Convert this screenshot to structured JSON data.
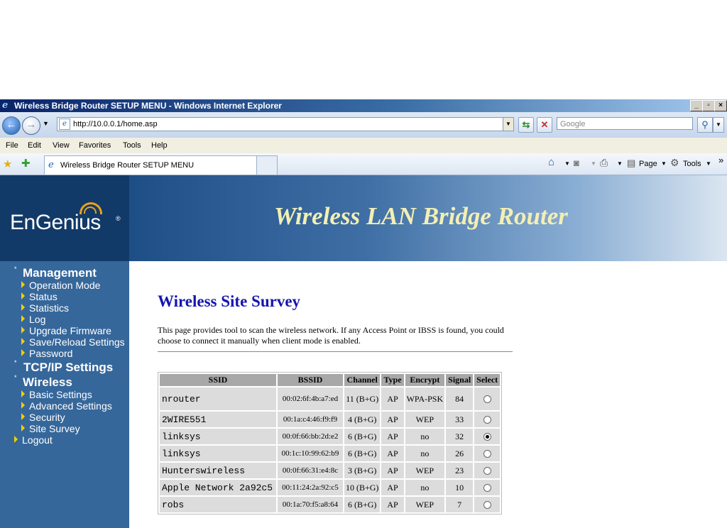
{
  "window": {
    "title": "Wireless Bridge Router SETUP MENU - Windows Internet Explorer",
    "controls": [
      "_",
      "▫",
      "×"
    ]
  },
  "address_bar": {
    "url": "http://10.0.0.1/home.asp",
    "search_placeholder": "Google"
  },
  "menu": [
    "File",
    "Edit",
    "View",
    "Favorites",
    "Tools",
    "Help"
  ],
  "tabs": {
    "active_label": "Wireless Bridge Router SETUP MENU"
  },
  "command_bar": {
    "page_label": "Page",
    "tools_label": "Tools",
    "overflow": "»"
  },
  "header": {
    "logo_text": "EnGenius",
    "logo_mark": "®",
    "banner_title": "Wireless LAN Bridge Router"
  },
  "sidebar": {
    "management": {
      "label": "Management",
      "items": [
        "Operation Mode",
        "Status",
        "Statistics",
        "Log",
        "Upgrade Firmware",
        "Save/Reload Settings",
        "Password"
      ]
    },
    "tcpip": {
      "label": "TCP/IP Settings"
    },
    "wireless": {
      "label": "Wireless",
      "items": [
        "Basic Settings",
        "Advanced Settings",
        "Security",
        "Site Survey"
      ]
    },
    "logout": "Logout"
  },
  "main": {
    "title": "Wireless Site Survey",
    "description": "This page provides tool to scan the wireless network. If any Access Point or IBSS is found, you could choose to connect it manually when client mode is enabled.",
    "table": {
      "headers": [
        "SSID",
        "BSSID",
        "Channel",
        "Type",
        "Encrypt",
        "Signal",
        "Select"
      ],
      "rows": [
        {
          "ssid": "nrouter",
          "bssid": "00:02:6f:4b:a7:ed",
          "channel": "11 (B+G)",
          "type": "AP",
          "encrypt": "WPA-PSK",
          "signal": "84",
          "selected": false
        },
        {
          "ssid": "2WIRE551",
          "bssid": "00:1a:c4:46:f9:f9",
          "channel": "4 (B+G)",
          "type": "AP",
          "encrypt": "WEP",
          "signal": "33",
          "selected": false
        },
        {
          "ssid": "linksys",
          "bssid": "00:0f:66:bb:2d:e2",
          "channel": "6 (B+G)",
          "type": "AP",
          "encrypt": "no",
          "signal": "32",
          "selected": true
        },
        {
          "ssid": "linksys",
          "bssid": "00:1c:10:99:62:b9",
          "channel": "6 (B+G)",
          "type": "AP",
          "encrypt": "no",
          "signal": "26",
          "selected": false
        },
        {
          "ssid": "Hunterswireless",
          "bssid": "00:0f:66:31:e4:8c",
          "channel": "3 (B+G)",
          "type": "AP",
          "encrypt": "WEP",
          "signal": "23",
          "selected": false
        },
        {
          "ssid": "Apple Network 2a92c5",
          "bssid": "00:11:24:2a:92:c5",
          "channel": "10 (B+G)",
          "type": "AP",
          "encrypt": "no",
          "signal": "10",
          "selected": false
        },
        {
          "ssid": "robs",
          "bssid": "00:1a:70:f5:a8:64",
          "channel": "6 (B+G)",
          "type": "AP",
          "encrypt": "WEP",
          "signal": "7",
          "selected": false
        }
      ]
    }
  }
}
